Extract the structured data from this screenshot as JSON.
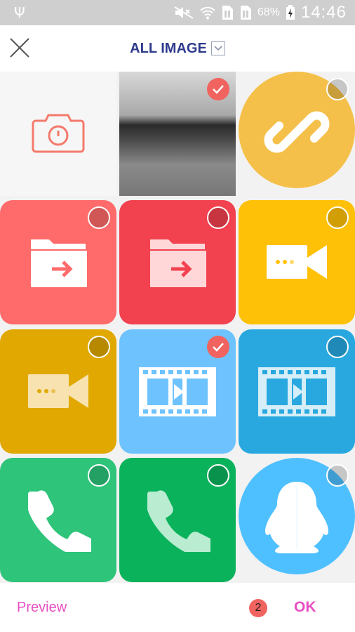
{
  "status_bar": {
    "battery_percent": "68%",
    "time": "14:46",
    "icons": [
      "usb-icon",
      "mute-icon",
      "wifi-icon",
      "sim1-icon",
      "sim2-icon",
      "charging-icon"
    ]
  },
  "header": {
    "title": "ALL IMAGE",
    "close_icon": "close-icon",
    "dropdown_icon": "chevron-down-icon"
  },
  "grid": {
    "tiles": [
      {
        "name": "camera-tile",
        "icon": "camera-icon",
        "bg": "#f6f6f6",
        "checked": null
      },
      {
        "name": "photo-tile",
        "icon": "photo",
        "bg": "#7e7e7e",
        "checked": true
      },
      {
        "name": "link-app-tile",
        "icon": "link-icon",
        "bg": "#f5c04a",
        "checked": false
      },
      {
        "name": "folder-share-tile-1",
        "icon": "folder-arrow-icon",
        "bg": "#ff6b6b",
        "checked": false
      },
      {
        "name": "folder-share-tile-2",
        "icon": "folder-arrow-icon",
        "bg": "#f2414f",
        "checked": false
      },
      {
        "name": "video-call-tile-1",
        "icon": "video-camera-icon",
        "bg": "#ffc107",
        "checked": false
      },
      {
        "name": "video-call-tile-2",
        "icon": "video-camera-icon",
        "bg": "#e0a800",
        "checked": false
      },
      {
        "name": "film-tile-1",
        "icon": "film-icon",
        "bg": "#6ec3ff",
        "checked": true
      },
      {
        "name": "film-tile-2",
        "icon": "film-icon",
        "bg": "#29a8e0",
        "checked": false
      },
      {
        "name": "phone-tile-1",
        "icon": "phone-icon",
        "bg": "#2ec47a",
        "checked": false
      },
      {
        "name": "phone-tile-2",
        "icon": "phone-icon",
        "bg": "#0bb25c",
        "checked": false
      },
      {
        "name": "penguin-tile",
        "icon": "penguin-icon",
        "bg": "#4fc0ff",
        "checked": false
      }
    ]
  },
  "footer": {
    "preview_label": "Preview",
    "selected_count": "2",
    "ok_label": "OK"
  },
  "colors": {
    "title": "#2e3a8c",
    "accent": "#e84ec2",
    "check": "#f0635f"
  }
}
